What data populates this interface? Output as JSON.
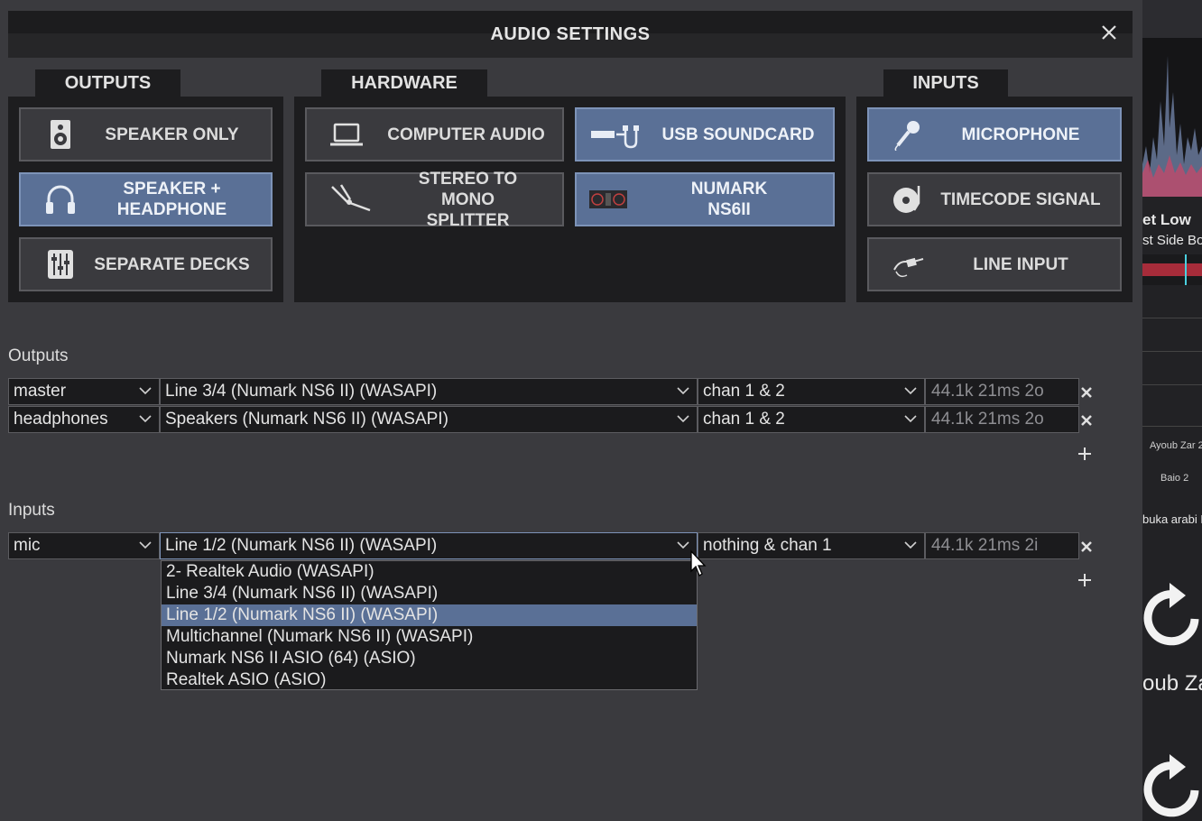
{
  "window": {
    "title": "AUDIO SETTINGS"
  },
  "tabs": {
    "outputs": "OUTPUTS",
    "hardware": "HARDWARE",
    "inputs": "INPUTS"
  },
  "output_buttons": [
    {
      "label": "SPEAKER ONLY",
      "icon": "speaker-icon",
      "active": false
    },
    {
      "label": "SPEAKER + HEADPHONE",
      "icon": "headphones-icon",
      "active": true
    },
    {
      "label": "SEPARATE DECKS",
      "icon": "mixer-sliders-icon",
      "active": false
    }
  ],
  "hardware_buttons": [
    {
      "label": "COMPUTER AUDIO",
      "icon": "laptop-icon",
      "active": false
    },
    {
      "label": "USB SOUNDCARD",
      "icon": "usb-soundcard-icon",
      "active": true
    },
    {
      "label": "STEREO TO MONO SPLITTER",
      "icon": "splitter-cable-icon",
      "active": false
    },
    {
      "label": "NUMARK NS6II",
      "icon": "controller-icon",
      "active": true
    }
  ],
  "input_buttons": [
    {
      "label": "MICROPHONE",
      "icon": "microphone-icon",
      "active": true
    },
    {
      "label": "TIMECODE SIGNAL",
      "icon": "timecode-vinyl-icon",
      "active": false
    },
    {
      "label": "LINE INPUT",
      "icon": "line-cable-icon",
      "active": false
    }
  ],
  "outputs": {
    "label": "Outputs",
    "rows": [
      {
        "role": "master",
        "device": "Line 3/4 (Numark NS6 II) (WASAPI)",
        "channels": "chan 1 & 2",
        "info": "44.1k 21ms 2o"
      },
      {
        "role": "headphones",
        "device": "Speakers (Numark NS6 II) (WASAPI)",
        "channels": "chan 1 & 2",
        "info": "44.1k 21ms 2o"
      }
    ]
  },
  "inputs": {
    "label": "Inputs",
    "rows": [
      {
        "role": "mic",
        "device": "Line 1/2 (Numark NS6 II) (WASAPI)",
        "channels": "nothing & chan 1",
        "info": "44.1k 21ms 2i"
      }
    ]
  },
  "device_dropdown": {
    "options": [
      "2- Realtek Audio (WASAPI)",
      "Line 3/4 (Numark NS6 II) (WASAPI)",
      "Line 1/2 (Numark NS6 II) (WASAPI)",
      "Multichannel (Numark NS6 II) (WASAPI)",
      "Numark NS6 II ASIO (64) (ASIO)",
      "Realtek ASIO (ASIO)"
    ],
    "selected": "Line 1/2 (Numark NS6 II) (WASAPI)"
  },
  "background_app": {
    "track_title": "et Low",
    "track_artist": "st Side Bo",
    "deck_label_1": "Ayoub Zar 2",
    "deck_label_2": "Baio 2",
    "browser_text": "buka arabi M",
    "big_label": "oub Zar"
  },
  "colors": {
    "active": "#5a7096",
    "panel": "#1d1d1f",
    "dialog": "#3a3a3e"
  }
}
